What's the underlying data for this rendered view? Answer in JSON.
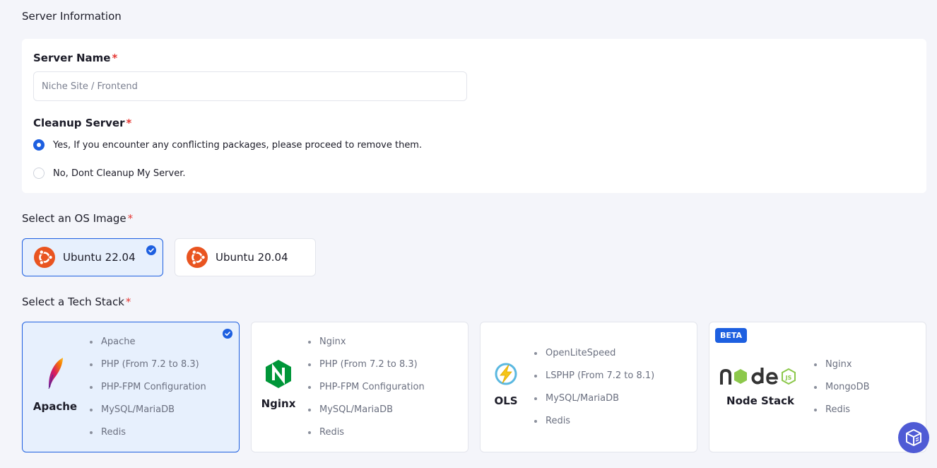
{
  "server_info": {
    "section_title": "Server Information",
    "server_name": {
      "label": "Server Name",
      "required_mark": "*",
      "placeholder": "Niche Site / Frontend",
      "value": ""
    },
    "cleanup": {
      "label": "Cleanup Server",
      "required_mark": "*",
      "options": [
        {
          "label": "Yes, If you encounter any conflicting packages, please proceed to remove them.",
          "selected": true
        },
        {
          "label": "No, Dont Cleanup My Server.",
          "selected": false
        }
      ]
    }
  },
  "os_image": {
    "section_title": "Select an OS Image",
    "required_mark": "*",
    "options": [
      {
        "label": "Ubuntu 22.04",
        "icon": "ubuntu-icon",
        "selected": true
      },
      {
        "label": "Ubuntu 20.04",
        "icon": "ubuntu-icon",
        "selected": false
      }
    ]
  },
  "tech_stack": {
    "section_title": "Select a Tech Stack",
    "required_mark": "*",
    "stacks": [
      {
        "name": "Apache",
        "icon": "apache-feather-icon",
        "selected": true,
        "features": [
          "Apache",
          "PHP (From 7.2 to 8.3)",
          "PHP-FPM Configuration",
          "MySQL/MariaDB",
          "Redis"
        ]
      },
      {
        "name": "Nginx",
        "icon": "nginx-icon",
        "selected": false,
        "features": [
          "Nginx",
          "PHP (From 7.2 to 8.3)",
          "PHP-FPM Configuration",
          "MySQL/MariaDB",
          "Redis"
        ]
      },
      {
        "name": "OLS",
        "icon": "openlitespeed-icon",
        "selected": false,
        "features": [
          "OpenLiteSpeed",
          "LSPHP (From 7.2 to 8.1)",
          "MySQL/MariaDB",
          "Redis"
        ]
      },
      {
        "name": "Node Stack",
        "icon": "nodejs-icon",
        "selected": false,
        "badge": "BETA",
        "features": [
          "Nginx",
          "MongoDB",
          "Redis"
        ]
      }
    ]
  },
  "colors": {
    "accent": "#1d5fe0",
    "selected_bg": "#e7f0fd",
    "required": "#e53935",
    "ubuntu": "#e95420",
    "page_bg": "#f4f5fa"
  }
}
